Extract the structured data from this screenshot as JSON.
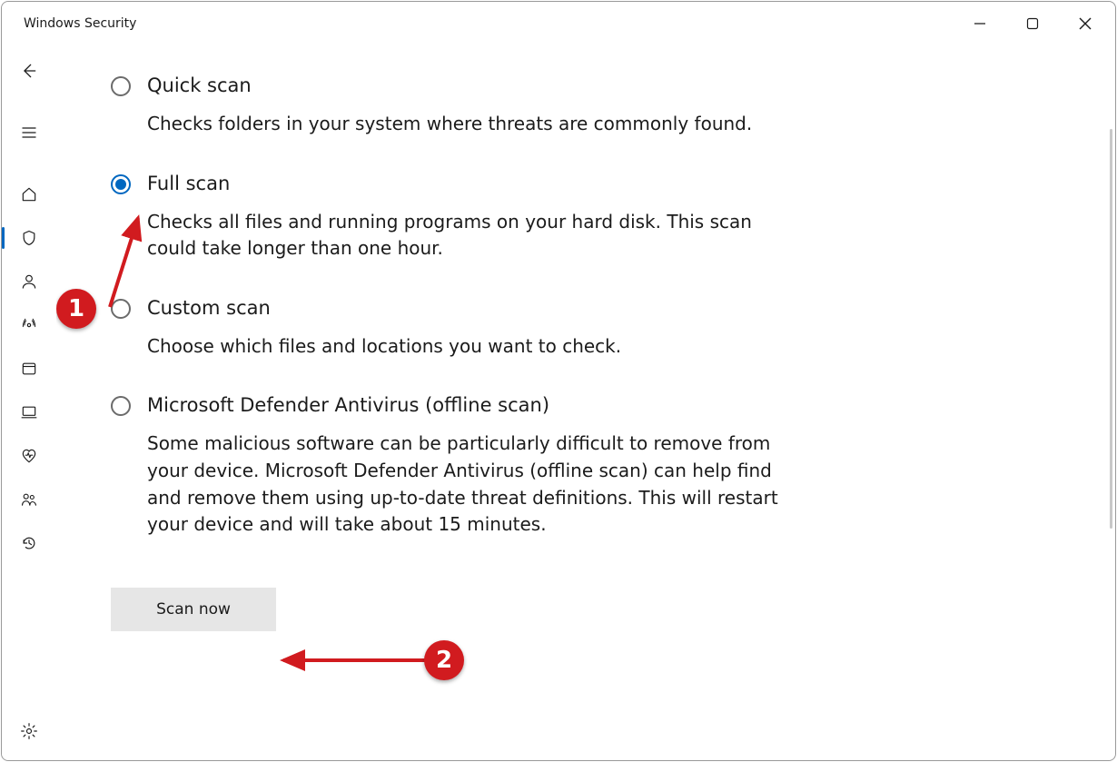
{
  "window": {
    "title": "Windows Security"
  },
  "nav": {
    "back": "back-icon",
    "menu": "hamburger-icon",
    "items": [
      {
        "icon": "home-icon"
      },
      {
        "icon": "shield-icon",
        "selected": true
      },
      {
        "icon": "person-icon"
      },
      {
        "icon": "firewall-icon"
      },
      {
        "icon": "app-browser-icon"
      },
      {
        "icon": "device-icon"
      },
      {
        "icon": "health-icon"
      },
      {
        "icon": "family-icon"
      },
      {
        "icon": "history-icon"
      }
    ],
    "settings": "settings-icon"
  },
  "scan_options": [
    {
      "id": "quick",
      "title": "Quick scan",
      "description": "Checks folders in your system where threats are commonly found.",
      "selected": false
    },
    {
      "id": "full",
      "title": "Full scan",
      "description": "Checks all files and running programs on your hard disk. This scan could take longer than one hour.",
      "selected": true
    },
    {
      "id": "custom",
      "title": "Custom scan",
      "description": "Choose which files and locations you want to check.",
      "selected": false
    },
    {
      "id": "offline",
      "title": "Microsoft Defender Antivirus (offline scan)",
      "description": "Some malicious software can be particularly difficult to remove from your device. Microsoft Defender Antivirus (offline scan) can help find and remove them using up-to-date threat definitions. This will restart your device and will take about 15 minutes.",
      "selected": false
    }
  ],
  "action_button": "Scan now",
  "annotations": {
    "step1": "1",
    "step2": "2"
  }
}
